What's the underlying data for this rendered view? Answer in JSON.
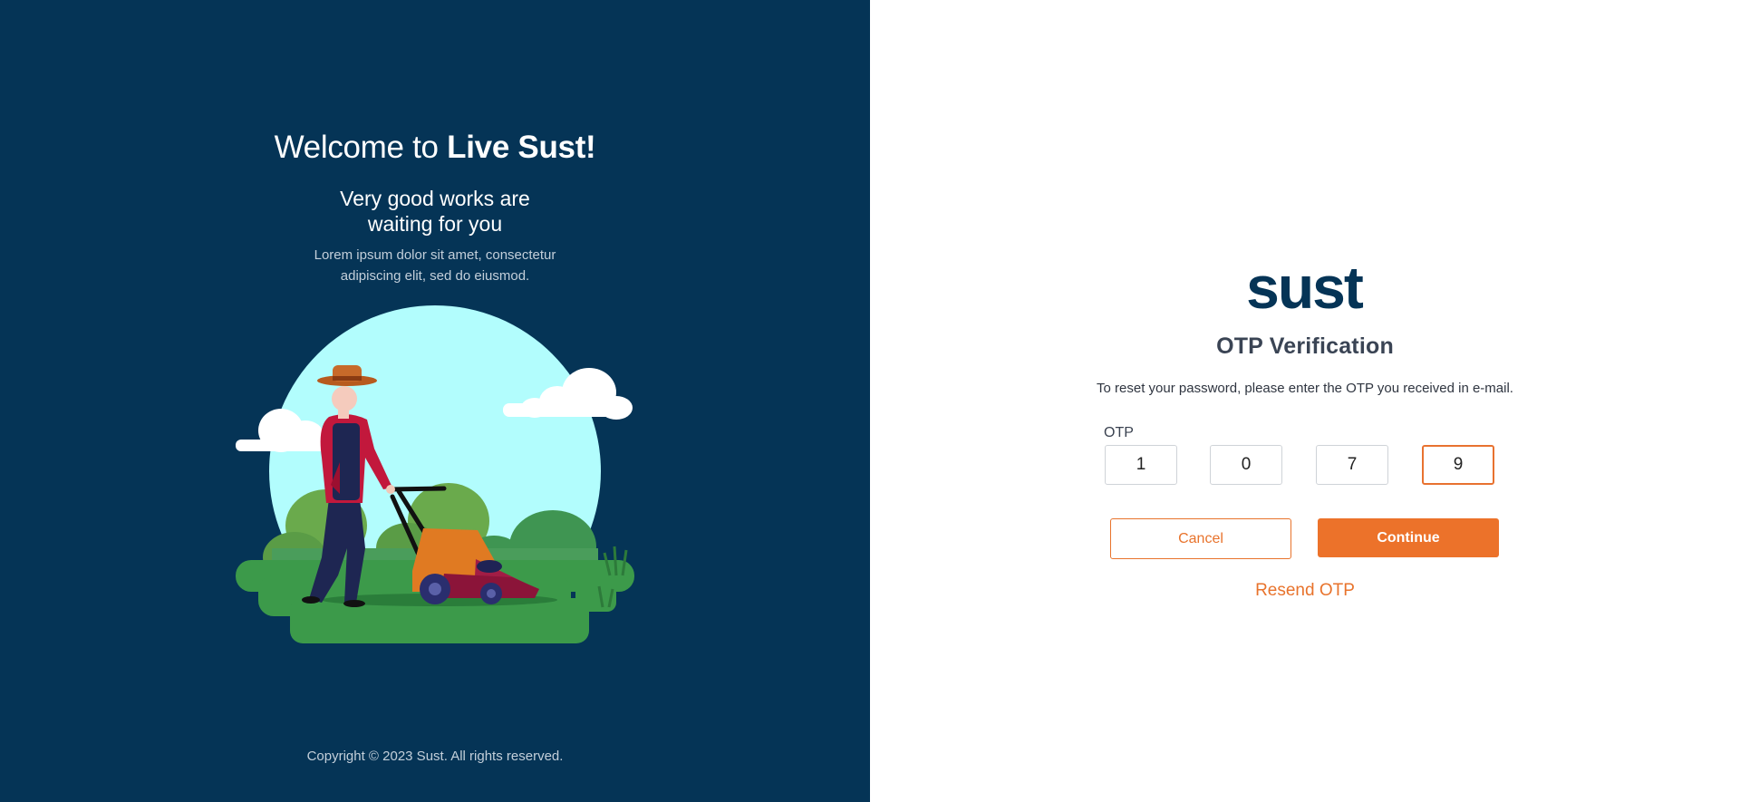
{
  "left_panel": {
    "welcome_prefix": "Welcome to ",
    "welcome_brand": "Live Sust!",
    "tagline_line1": "Very good works are",
    "tagline_line2": "waiting for you",
    "lorem_line1": "Lorem ipsum dolor sit amet, consectetur",
    "lorem_line2": "adipiscing elit, sed do eiusmod.",
    "copyright": "Copyright © 2023 Sust. All rights reserved.",
    "background_color": "#053456",
    "illustration_icon": "man-mowing-lawn-illustration"
  },
  "form": {
    "logo_text": "sust",
    "title": "OTP Verification",
    "instructions": "To reset your password, please enter the OTP you received in e-mail.",
    "otp_label": "OTP",
    "otp_digits": [
      "1",
      "0",
      "7",
      "9"
    ],
    "cancel_label": "Cancel",
    "continue_label": "Continue",
    "resend_label": "Resend OTP",
    "accent_color": "#ec722a",
    "brand_color": "#053456"
  }
}
